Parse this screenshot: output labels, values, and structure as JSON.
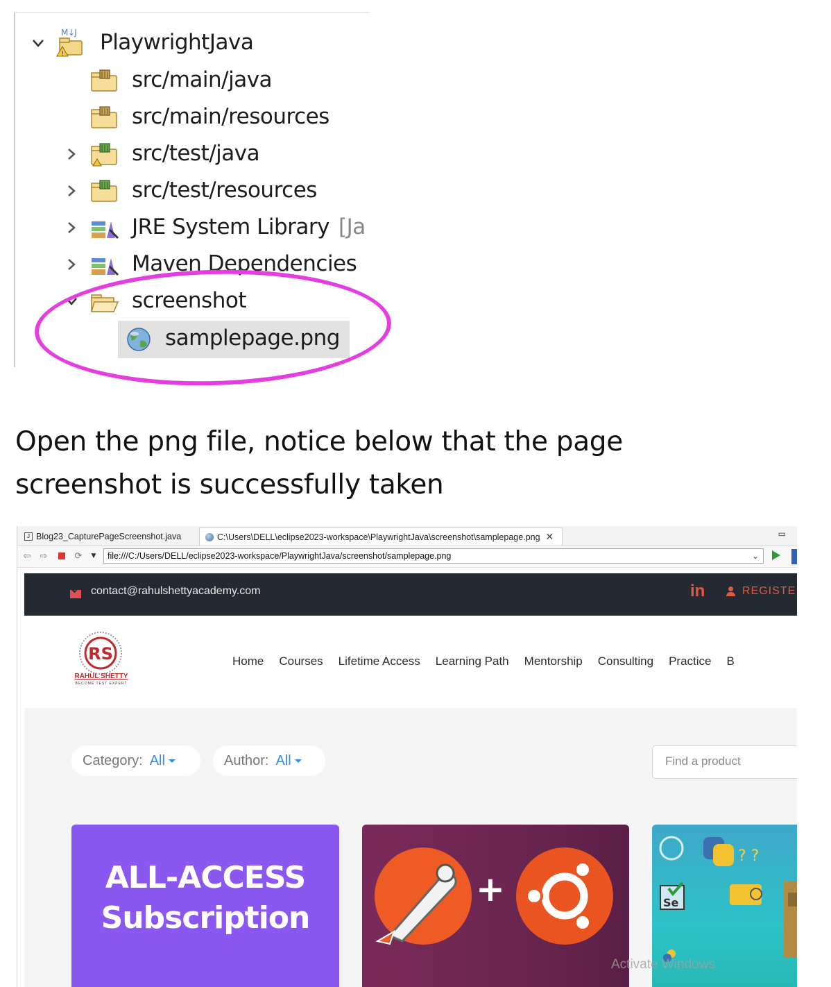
{
  "explorer": {
    "project_name": "PlaywrightJava",
    "project_badge": "M↓J",
    "items": [
      {
        "label": "src/main/java"
      },
      {
        "label": "src/main/resources"
      },
      {
        "label": "src/test/java"
      },
      {
        "label": "src/test/resources"
      },
      {
        "label": "JRE System Library",
        "suffix": "[Ja"
      },
      {
        "label": "Maven Dependencies"
      },
      {
        "label": "screenshot"
      },
      {
        "label": "samplepage.png"
      }
    ]
  },
  "caption": {
    "line1": "Open the png file, notice below that the page",
    "line2": "screenshot is successfully taken"
  },
  "browser": {
    "tabs": [
      {
        "label": "Blog23_CapturePageScreenshot.java"
      },
      {
        "label": "C:\\Users\\DELL\\eclipse2023-workspace\\PlaywrightJava\\screenshot\\samplepage.png"
      }
    ],
    "url": "file:///C:/Users/DELL/eclipse2023-workspace/PlaywrightJava/screenshot/samplepage.png"
  },
  "site": {
    "email": "contact@rahulshettyacademy.com",
    "linkedin": "in",
    "register": "REGISTE",
    "logo_text": "RAHUL SHETTY",
    "logo_sub": "BECOME TEST EXPERT",
    "nav": [
      "Home",
      "Courses",
      "Lifetime Access",
      "Learning Path",
      "Mentorship",
      "Consulting",
      "Practice",
      "B"
    ],
    "filters": {
      "category_label": "Category:",
      "category_value": "All",
      "author_label": "Author:",
      "author_value": "All"
    },
    "search_placeholder": "Find a product",
    "cards": {
      "card1_line1": "ALL-ACCESS",
      "card1_line2": "Subscription",
      "card2_plus": "+",
      "card3_badge": "Se"
    },
    "watermark": "Activate Windows"
  },
  "colors": {
    "highlight": "#e43ee0",
    "topbar": "#252a32",
    "accent": "#e05a42",
    "link": "#2f8ee0",
    "card1": "#8a57f0",
    "postman": "#ef5b25",
    "ubuntu": "#e95420"
  }
}
